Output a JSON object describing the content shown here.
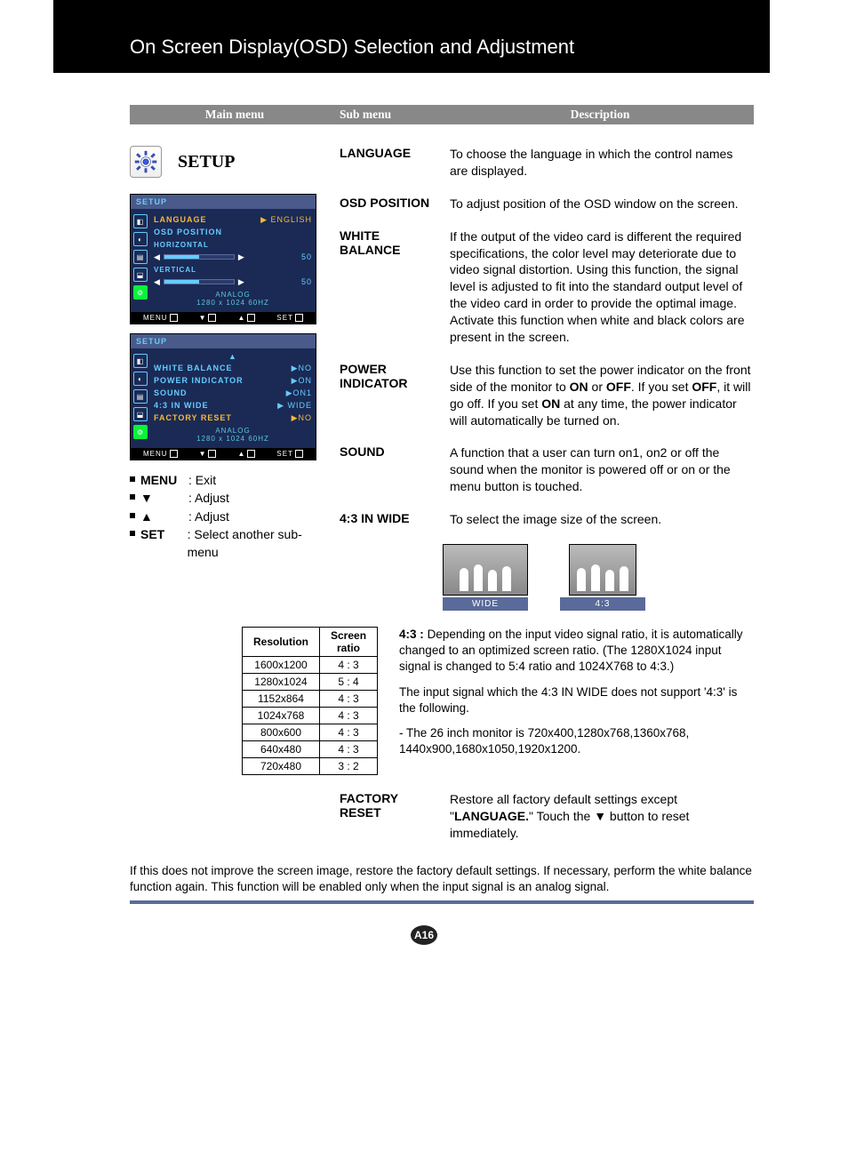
{
  "title": "On Screen Display(OSD) Selection and Adjustment",
  "headers": {
    "c1": "Main menu",
    "c2": "Sub menu",
    "c3": "Description"
  },
  "mainmenu": {
    "label": "SETUP"
  },
  "osd1": {
    "title": "SETUP",
    "rows": {
      "language_label": "LANGUAGE",
      "language_value": "ENGLISH",
      "position_label": "OSD POSITION",
      "horizontal": "HORIZONTAL",
      "vertical": "VERTICAL",
      "hv_value": "50",
      "analog": "ANALOG",
      "mode": "1280 x 1024  60HZ"
    },
    "foot": {
      "menu": "MENU",
      "down": "▼",
      "up": "▲",
      "set": "SET"
    }
  },
  "osd2": {
    "title": "SETUP",
    "rows": {
      "wb_label": "WHITE BALANCE",
      "wb_val": "NO",
      "pi_label": "POWER INDICATOR",
      "pi_val": "ON",
      "snd_label": "SOUND",
      "snd_val": "ON1",
      "ar_label": "4:3  IN WIDE",
      "ar_val": "WIDE",
      "fr_label": "FACTORY RESET",
      "fr_val": "NO",
      "analog": "ANALOG",
      "mode": "1280 x 1024  60HZ"
    },
    "foot": {
      "menu": "MENU",
      "down": "▼",
      "up": "▲",
      "set": "SET"
    }
  },
  "legend": {
    "menu_key": "MENU",
    "menu_desc": ": Exit",
    "down_desc": ": Adjust",
    "up_desc": ": Adjust",
    "set_key": "SET",
    "set_desc": ": Select another sub-menu"
  },
  "items": {
    "language": {
      "label": "LANGUAGE",
      "desc": "To choose the language in which the control names are displayed."
    },
    "osdposition": {
      "label": "OSD POSITION",
      "desc": "To adjust position of the OSD window on the screen."
    },
    "whitebalance": {
      "label": "WHITE BALANCE",
      "desc": "If the output of the video card is different the required specifications, the color level may deteriorate due to video signal distortion. Using this function, the signal level is adjusted to fit into the standard output level of the video card in order to provide the optimal image. Activate this function when white and black colors are present in the screen."
    },
    "powerindicator": {
      "label": "POWER INDICATOR",
      "desc_pre": "Use this function to set the power indicator on the front side of the monitor to ",
      "on": "ON",
      "or": " or ",
      "off": "OFF",
      "desc_mid": ". If you set ",
      "off2": "OFF",
      "desc_mid2": ", it will go off. If you set ",
      "on2": "ON",
      "desc_post": " at any time, the power indicator will automatically be turned on."
    },
    "sound": {
      "label": "SOUND",
      "desc": "A function that a user can turn on1, on2 or off the sound when the monitor is powered off or on or the menu button is touched."
    },
    "wide": {
      "label": "4:3 IN WIDE",
      "desc": "To select the image size of the screen."
    },
    "aspect": {
      "wide": "WIDE",
      "ar": "4:3"
    },
    "wide_note_a": "4:3 : Depending on the input video signal ratio, it is automatically changed to an optimized screen ratio. (The 1280X1024 input signal is changed to 5:4 ratio and 1024X768 to 4:3.)",
    "wide_note_b": "The input signal which the 4:3 IN WIDE does not support  '4:3' is the following.",
    "wide_note_c": "- The 26 inch monitor is 720x400,1280x768,1360x768, 1440x900,1680x1050,1920x1200.",
    "factoryreset": {
      "label": "FACTORY RESET",
      "desc_a": "Restore all factory default settings except \"",
      "lang": "LANGUAGE.",
      "desc_b": "\" Touch the ▼ button to reset immediately."
    }
  },
  "res_table": {
    "h1": "Resolution",
    "h2": "Screen ratio",
    "rows": [
      {
        "r": "1600x1200",
        "s": "4 : 3"
      },
      {
        "r": "1280x1024",
        "s": "5 : 4"
      },
      {
        "r": "1152x864",
        "s": "4 : 3"
      },
      {
        "r": "1024x768",
        "s": "4 : 3"
      },
      {
        "r": "800x600",
        "s": "4 : 3"
      },
      {
        "r": "640x480",
        "s": "4 : 3"
      },
      {
        "r": "720x480",
        "s": "3 : 2"
      }
    ]
  },
  "footnote": "If this does not improve the screen image, restore the factory default settings. If necessary, perform the white balance function again. This function will be enabled only when the input signal is an analog signal.",
  "pagenum": "A16"
}
